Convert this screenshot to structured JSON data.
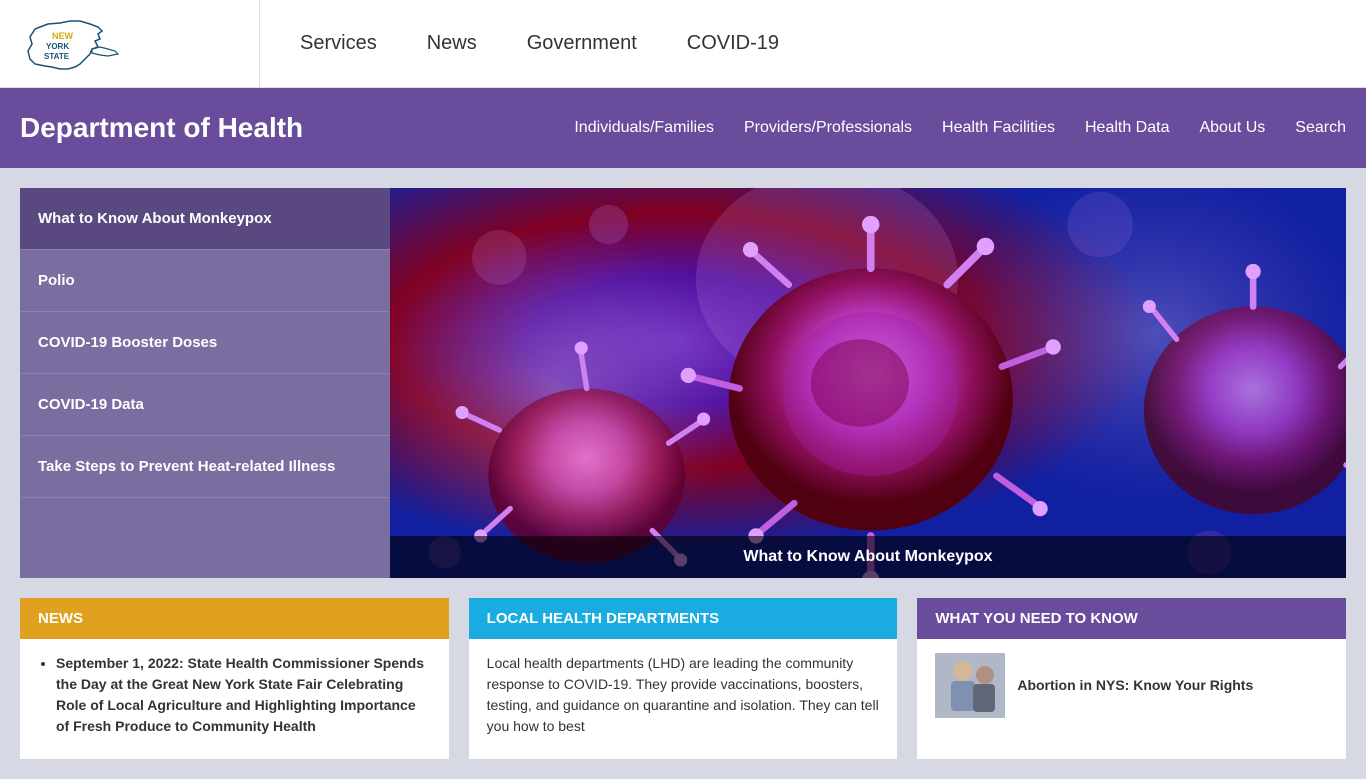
{
  "topNav": {
    "links": [
      {
        "id": "services",
        "label": "Services"
      },
      {
        "id": "news",
        "label": "News"
      },
      {
        "id": "government",
        "label": "Government"
      },
      {
        "id": "covid19",
        "label": "COVID-19"
      }
    ]
  },
  "deptHeader": {
    "title": "Department of Health",
    "navLinks": [
      {
        "id": "individuals-families",
        "label": "Individuals/Families"
      },
      {
        "id": "providers-professionals",
        "label": "Providers/Professionals"
      },
      {
        "id": "health-facilities",
        "label": "Health Facilities"
      },
      {
        "id": "health-data",
        "label": "Health Data"
      },
      {
        "id": "about-us",
        "label": "About Us"
      },
      {
        "id": "search",
        "label": "Search"
      }
    ]
  },
  "sidebar": {
    "items": [
      {
        "id": "monkeypox",
        "label": "What to Know About Monkeypox"
      },
      {
        "id": "polio",
        "label": "Polio"
      },
      {
        "id": "covid-booster",
        "label": "COVID-19 Booster Doses"
      },
      {
        "id": "covid-data",
        "label": "COVID-19 Data"
      },
      {
        "id": "heat-illness",
        "label": "Take Steps to Prevent Heat-related Illness"
      }
    ]
  },
  "featuredCaption": "What to Know About Monkeypox",
  "bottomSections": {
    "news": {
      "header": "NEWS",
      "items": [
        {
          "text": "September 1, 2022: State Health Commissioner Spends the Day at the Great New York State Fair Celebrating Role of Local Agriculture and Highlighting Importance of Fresh Produce to Community Health"
        }
      ]
    },
    "lhd": {
      "header": "LOCAL HEALTH DEPARTMENTS",
      "body": "Local health departments (LHD) are leading the community response to COVID-19. They provide vaccinations, boosters, testing, and guidance on quarantine and isolation. They can tell you how to best"
    },
    "wynk": {
      "header": "WHAT YOU NEED TO KNOW",
      "item": {
        "title": "Abortion in NYS: Know Your Rights"
      }
    }
  },
  "logo": {
    "altText": "New York State",
    "colors": {
      "outline": "#1a5276",
      "newText": "#d4ac0d",
      "yorkStateText": "#1a5276"
    }
  }
}
